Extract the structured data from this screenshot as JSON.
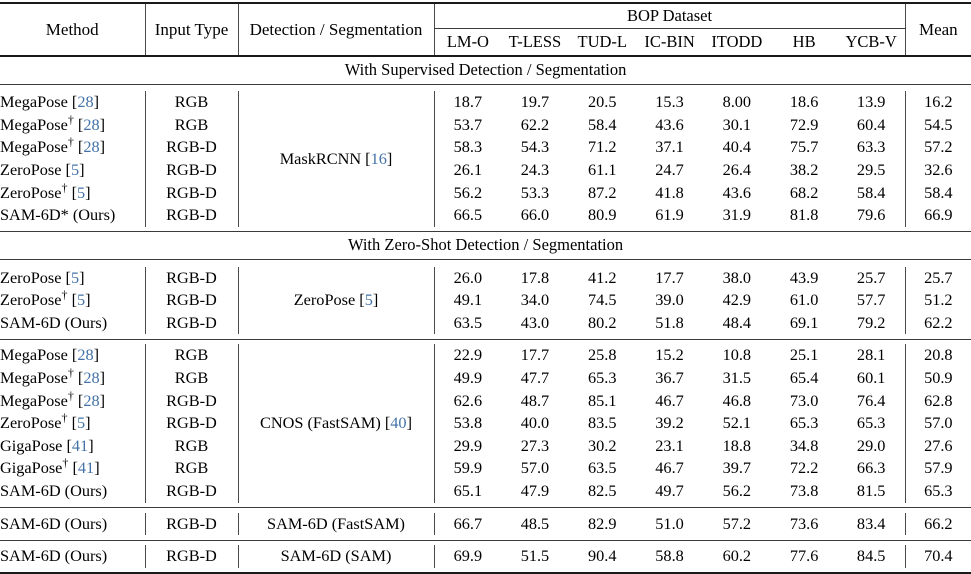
{
  "table": {
    "headers": {
      "method": "Method",
      "input_type": "Input Type",
      "detection_segmentation": "Detection / Segmentation",
      "group": "BOP Dataset",
      "datasets": [
        "LM-O",
        "T-LESS",
        "TUD-L",
        "IC-BIN",
        "ITODD",
        "HB",
        "YCB-V"
      ],
      "mean": "Mean"
    },
    "sections": [
      {
        "banner": "With Supervised Detection / Segmentation",
        "detector": "MaskRCNN [16]",
        "detector_text": "MaskRCNN",
        "detector_cite": "16",
        "rows": [
          {
            "method": "MegaPose",
            "dagger": false,
            "star": false,
            "cite": "28",
            "suffix": "",
            "input": "RGB",
            "values": [
              "18.7",
              "19.7",
              "20.5",
              "15.3",
              "8.00",
              "18.6",
              "13.9"
            ],
            "bold": [
              false,
              false,
              false,
              false,
              false,
              false,
              false
            ],
            "mean": "16.2",
            "mean_bold": false
          },
          {
            "method": "MegaPose",
            "dagger": true,
            "star": false,
            "cite": "28",
            "suffix": "",
            "input": "RGB",
            "values": [
              "53.7",
              "62.2",
              "58.4",
              "43.6",
              "30.1",
              "72.9",
              "60.4"
            ],
            "bold": [
              false,
              false,
              false,
              false,
              false,
              false,
              false
            ],
            "mean": "54.5",
            "mean_bold": false
          },
          {
            "method": "MegaPose",
            "dagger": true,
            "star": false,
            "cite": "28",
            "suffix": "",
            "input": "RGB-D",
            "values": [
              "58.3",
              "54.3",
              "71.2",
              "37.1",
              "40.4",
              "75.7",
              "63.3"
            ],
            "bold": [
              false,
              false,
              false,
              false,
              false,
              false,
              false
            ],
            "mean": "57.2",
            "mean_bold": false
          },
          {
            "method": "ZeroPose",
            "dagger": false,
            "star": false,
            "cite": "5",
            "suffix": "",
            "input": "RGB-D",
            "values": [
              "26.1",
              "24.3",
              "61.1",
              "24.7",
              "26.4",
              "38.2",
              "29.5"
            ],
            "bold": [
              false,
              false,
              false,
              false,
              false,
              false,
              false
            ],
            "mean": "32.6",
            "mean_bold": false
          },
          {
            "method": "ZeroPose",
            "dagger": true,
            "star": false,
            "cite": "5",
            "suffix": "",
            "input": "RGB-D",
            "values": [
              "56.2",
              "53.3",
              "87.2",
              "41.8",
              "43.6",
              "68.2",
              "58.4"
            ],
            "bold": [
              false,
              false,
              true,
              false,
              true,
              false,
              false
            ],
            "mean": "58.4",
            "mean_bold": false
          },
          {
            "method": "SAM-6D",
            "dagger": false,
            "star": true,
            "cite": null,
            "suffix": "(Ours)",
            "input": "RGB-D",
            "values": [
              "66.5",
              "66.0",
              "80.9",
              "61.9",
              "31.9",
              "81.8",
              "79.6"
            ],
            "bold": [
              true,
              true,
              false,
              true,
              false,
              true,
              true
            ],
            "mean": "66.9",
            "mean_bold": true
          }
        ]
      },
      {
        "banner": "With Zero-Shot Detection / Segmentation",
        "detector": "ZeroPose [5]",
        "detector_text": "ZeroPose",
        "detector_cite": "5",
        "rows": [
          {
            "method": "ZeroPose",
            "dagger": false,
            "star": false,
            "cite": "5",
            "suffix": "",
            "input": "RGB-D",
            "values": [
              "26.0",
              "17.8",
              "41.2",
              "17.7",
              "38.0",
              "43.9",
              "25.7"
            ],
            "bold": [
              false,
              false,
              false,
              false,
              false,
              false,
              false
            ],
            "mean": "25.7",
            "mean_bold": false
          },
          {
            "method": "ZeroPose",
            "dagger": true,
            "star": false,
            "cite": "5",
            "suffix": "",
            "input": "RGB-D",
            "values": [
              "49.1",
              "34.0",
              "74.5",
              "39.0",
              "42.9",
              "61.0",
              "57.7"
            ],
            "bold": [
              false,
              false,
              false,
              false,
              false,
              false,
              false
            ],
            "mean": "51.2",
            "mean_bold": false
          },
          {
            "method": "SAM-6D",
            "dagger": false,
            "star": false,
            "cite": null,
            "suffix": "(Ours)",
            "input": "RGB-D",
            "values": [
              "63.5",
              "43.0",
              "80.2",
              "51.8",
              "48.4",
              "69.1",
              "79.2"
            ],
            "bold": [
              true,
              true,
              true,
              true,
              true,
              true,
              true
            ],
            "mean": "62.2",
            "mean_bold": true
          }
        ]
      }
    ],
    "cnos_group": {
      "detector": "CNOS (FastSAM) [40]",
      "detector_text": "CNOS (FastSAM)",
      "detector_cite": "40",
      "rows": [
        {
          "method": "MegaPose",
          "dagger": false,
          "star": false,
          "cite": "28",
          "suffix": "",
          "input": "RGB",
          "values": [
            "22.9",
            "17.7",
            "25.8",
            "15.2",
            "10.8",
            "25.1",
            "28.1"
          ],
          "bold": [
            false,
            false,
            false,
            false,
            false,
            false,
            false
          ],
          "mean": "20.8",
          "mean_bold": false
        },
        {
          "method": "MegaPose",
          "dagger": true,
          "star": false,
          "cite": "28",
          "suffix": "",
          "input": "RGB",
          "values": [
            "49.9",
            "47.7",
            "65.3",
            "36.7",
            "31.5",
            "65.4",
            "60.1"
          ],
          "bold": [
            false,
            false,
            false,
            false,
            false,
            false,
            false
          ],
          "mean": "50.9",
          "mean_bold": false
        },
        {
          "method": "MegaPose",
          "dagger": true,
          "star": false,
          "cite": "28",
          "suffix": "",
          "input": "RGB-D",
          "values": [
            "62.6",
            "48.7",
            "85.1",
            "46.7",
            "46.8",
            "73.0",
            "76.4"
          ],
          "bold": [
            false,
            false,
            true,
            false,
            false,
            false,
            false
          ],
          "mean": "62.8",
          "mean_bold": false
        },
        {
          "method": "ZeroPose",
          "dagger": true,
          "star": false,
          "cite": "5",
          "suffix": "",
          "input": "RGB-D",
          "values": [
            "53.8",
            "40.0",
            "83.5",
            "39.2",
            "52.1",
            "65.3",
            "65.3"
          ],
          "bold": [
            false,
            false,
            false,
            false,
            false,
            false,
            false
          ],
          "mean": "57.0",
          "mean_bold": false
        },
        {
          "method": "GigaPose",
          "dagger": false,
          "star": false,
          "cite": "41",
          "suffix": "",
          "input": "RGB",
          "values": [
            "29.9",
            "27.3",
            "30.2",
            "23.1",
            "18.8",
            "34.8",
            "29.0"
          ],
          "bold": [
            false,
            false,
            false,
            false,
            false,
            false,
            false
          ],
          "mean": "27.6",
          "mean_bold": false
        },
        {
          "method": "GigaPose",
          "dagger": true,
          "star": false,
          "cite": "41",
          "suffix": "",
          "input": "RGB",
          "values": [
            "59.9",
            "57.0",
            "63.5",
            "46.7",
            "39.7",
            "72.2",
            "66.3"
          ],
          "bold": [
            false,
            true,
            false,
            false,
            false,
            false,
            false
          ],
          "mean": "57.9",
          "mean_bold": false
        },
        {
          "method": "SAM-6D",
          "dagger": false,
          "star": false,
          "cite": null,
          "suffix": "(Ours)",
          "input": "RGB-D",
          "values": [
            "65.1",
            "47.9",
            "82.5",
            "49.7",
            "56.2",
            "73.8",
            "81.5"
          ],
          "bold": [
            true,
            false,
            false,
            true,
            true,
            true,
            true
          ],
          "mean": "65.3",
          "mean_bold": true
        }
      ]
    },
    "final_rows": [
      {
        "method": "SAM-6D",
        "dagger": false,
        "star": false,
        "cite": null,
        "suffix": "(Ours)",
        "input": "RGB-D",
        "detector": "SAM-6D (FastSAM)",
        "values": [
          "66.7",
          "48.5",
          "82.9",
          "51.0",
          "57.2",
          "73.6",
          "83.4"
        ],
        "bold": [
          true,
          true,
          true,
          true,
          true,
          true,
          true
        ],
        "mean": "66.2",
        "mean_bold": true
      },
      {
        "method": "SAM-6D",
        "dagger": false,
        "star": false,
        "cite": null,
        "suffix": "(Ours)",
        "input": "RGB-D",
        "detector": "SAM-6D (SAM)",
        "values": [
          "69.9",
          "51.5",
          "90.4",
          "58.8",
          "60.2",
          "77.6",
          "84.5"
        ],
        "bold": [
          true,
          true,
          true,
          true,
          true,
          true,
          true
        ],
        "mean": "70.4",
        "mean_bold": true
      }
    ],
    "colors": {
      "citation": "#4472a8",
      "rule": "#1a1a1a",
      "text": "#000000"
    }
  }
}
